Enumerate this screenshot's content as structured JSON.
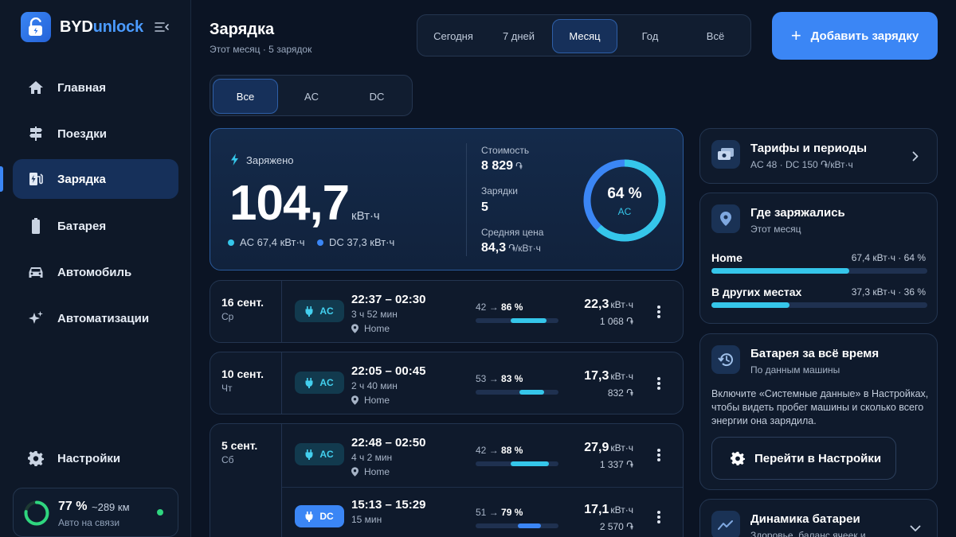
{
  "app": {
    "brand_part1": "BYD",
    "brand_part2": "unlock"
  },
  "sidebar": {
    "items": [
      {
        "label": "Главная",
        "icon": "home-icon"
      },
      {
        "label": "Поездки",
        "icon": "signpost-icon"
      },
      {
        "label": "Зарядка",
        "icon": "ev-station-icon",
        "active": true
      },
      {
        "label": "Батарея",
        "icon": "battery-icon"
      },
      {
        "label": "Автомобиль",
        "icon": "car-icon"
      },
      {
        "label": "Автоматизации",
        "icon": "sparkle-icon"
      }
    ],
    "settings_label": "Настройки"
  },
  "car_status": {
    "battery_pct": "77 %",
    "battery_fraction": 0.77,
    "range": "~289 км",
    "connection": "Авто на связи"
  },
  "header": {
    "title": "Зарядка",
    "subtitle": "Этот месяц · 5 зарядок",
    "periods": [
      "Сегодня",
      "7 дней",
      "Месяц",
      "Год",
      "Всё"
    ],
    "active_period": "Месяц",
    "add_button": "Добавить зарядку"
  },
  "type_filter": {
    "options": [
      "Все",
      "AC",
      "DC"
    ],
    "active": "Все"
  },
  "summary": {
    "charged_label": "Заряжено",
    "total_value": "104,7",
    "total_unit": "кВт·ч",
    "ac_legend": "AC 67,4 кВт·ч",
    "dc_legend": "DC 37,3 кВт·ч",
    "cost_label": "Стоимость",
    "cost_value": "8 829",
    "cost_unit": "֏",
    "count_label": "Зарядки",
    "count_value": "5",
    "avg_label": "Средняя цена",
    "avg_value": "84,3",
    "avg_unit": "֏/кВт·ч",
    "donut_pct": "64 %",
    "donut_label": "AC",
    "donut_fraction": 0.64,
    "colors": {
      "ac": "#35c6ea",
      "dc": "#3b86f5"
    }
  },
  "days": [
    {
      "date": "16 сент.",
      "dow": "Ср",
      "sessions": [
        {
          "type": "AC",
          "time": "22:37 – 02:30",
          "duration": "3 ч 52 мин",
          "location": "Home",
          "soc_from": "42",
          "soc_to": "86 %",
          "from_frac": 0.42,
          "to_frac": 0.86,
          "kwh": "22,3",
          "kwh_unit": "кВт·ч",
          "cost": "1 068 ֏"
        }
      ]
    },
    {
      "date": "10 сент.",
      "dow": "Чт",
      "sessions": [
        {
          "type": "AC",
          "time": "22:05 – 00:45",
          "duration": "2 ч 40 мин",
          "location": "Home",
          "soc_from": "53",
          "soc_to": "83 %",
          "from_frac": 0.53,
          "to_frac": 0.83,
          "kwh": "17,3",
          "kwh_unit": "кВт·ч",
          "cost": "832 ֏"
        }
      ]
    },
    {
      "date": "5 сент.",
      "dow": "Сб",
      "sessions": [
        {
          "type": "AC",
          "time": "22:48 – 02:50",
          "duration": "4 ч 2 мин",
          "location": "Home",
          "soc_from": "42",
          "soc_to": "88 %",
          "from_frac": 0.42,
          "to_frac": 0.88,
          "kwh": "27,9",
          "kwh_unit": "кВт·ч",
          "cost": "1 337 ֏"
        },
        {
          "type": "DC",
          "time": "15:13 – 15:29",
          "duration": "15 мин",
          "location": "",
          "soc_from": "51",
          "soc_to": "79 %",
          "from_frac": 0.51,
          "to_frac": 0.79,
          "kwh": "17,1",
          "kwh_unit": "кВт·ч",
          "cost": "2 570 ֏"
        }
      ]
    }
  ],
  "panels": {
    "tariffs": {
      "title": "Тарифы и периоды",
      "subtitle": "AC 48 · DC 150 ֏/кВт·ч"
    },
    "locations": {
      "title": "Где заряжались",
      "subtitle": "Этот месяц",
      "rows": [
        {
          "name": "Home",
          "value": "67,4 кВт·ч · 64 %",
          "fraction": 0.64
        },
        {
          "name": "В других местах",
          "value": "37,3 кВт·ч · 36 %",
          "fraction": 0.36
        }
      ]
    },
    "battery_all_time": {
      "title": "Батарея за всё время",
      "subtitle": "По данным машины",
      "info": "Включите «Системные данные» в Настройках, чтобы видеть пробег машины и сколько всего энергии она зарядила.",
      "button": "Перейти в Настройки"
    },
    "battery_dynamics": {
      "title": "Динамика батареи",
      "subtitle": "Здоровье, баланс ячеек и"
    }
  }
}
